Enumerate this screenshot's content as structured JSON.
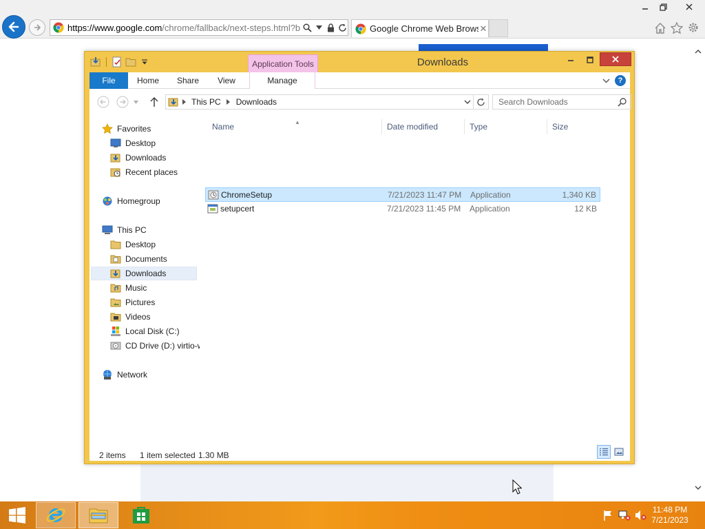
{
  "browser": {
    "url_host": "https://www.google.com",
    "url_rest": "/chrome/fallback/next-steps.html?brar",
    "tab_title": "Google Chrome Web Brows...",
    "tab_close": "✕"
  },
  "explorer": {
    "window_title": "Downloads",
    "context_tab_group": "Application Tools",
    "ribbon_tabs": {
      "file": "File",
      "home": "Home",
      "share": "Share",
      "view": "View",
      "manage": "Manage"
    },
    "help": "?",
    "breadcrumb": [
      "This PC",
      "Downloads"
    ],
    "search_placeholder": "Search Downloads",
    "sidebar": {
      "favorites": "Favorites",
      "fav_items": [
        "Desktop",
        "Downloads",
        "Recent places"
      ],
      "homegroup": "Homegroup",
      "this_pc": "This PC",
      "pc_items": [
        "Desktop",
        "Documents",
        "Downloads",
        "Music",
        "Pictures",
        "Videos",
        "Local Disk (C:)",
        "CD Drive (D:) virtio-win"
      ],
      "network": "Network"
    },
    "columns": {
      "name": "Name",
      "date": "Date modified",
      "type": "Type",
      "size": "Size"
    },
    "files": [
      {
        "name": "ChromeSetup",
        "date": "7/21/2023 11:47 PM",
        "type": "Application",
        "size": "1,340 KB",
        "selected": true
      },
      {
        "name": "setupcert",
        "date": "7/21/2023 11:45 PM",
        "type": "Application",
        "size": "12 KB",
        "selected": false
      }
    ],
    "status": {
      "count": "2 items",
      "selection": "1 item selected",
      "size": "1.30 MB"
    }
  },
  "taskbar": {
    "time": "11:48 PM",
    "date": "7/21/2023"
  },
  "colors": {
    "explorer_frame": "#f3c74d",
    "file_tab": "#1979ca",
    "app_tools": "#f4c3e8",
    "selection": "#cce8ff",
    "taskbar": "#f29a1a",
    "close_button": "#c7423b"
  }
}
